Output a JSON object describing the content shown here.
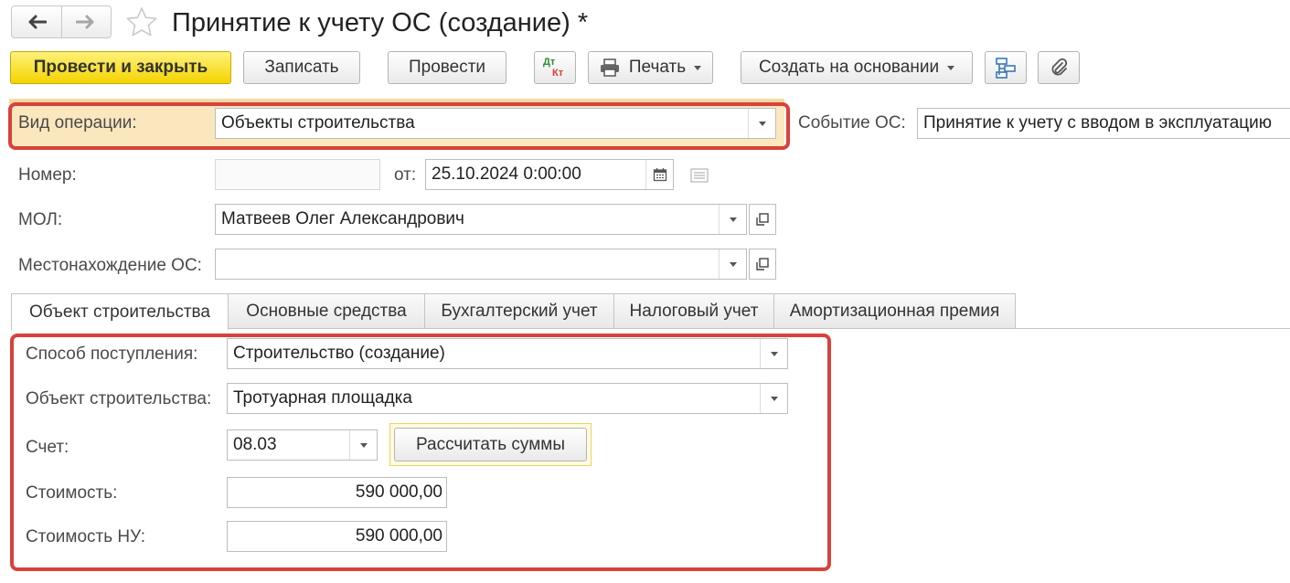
{
  "window": {
    "title": "Принятие к учету ОС (создание) *"
  },
  "toolbar": {
    "post_close": "Провести и закрыть",
    "save": "Записать",
    "post": "Провести",
    "dt": "Дт",
    "kt": "Кт",
    "print": "Печать",
    "create_based": "Создать на основании"
  },
  "header": {
    "operation_label": "Вид операции:",
    "operation_value": "Объекты строительства",
    "event_label": "Событие ОС:",
    "event_value": "Принятие к учету с вводом в эксплуатацию",
    "number_label": "Номер:",
    "number_value": "",
    "date_label": "от:",
    "date_value": "25.10.2024  0:00:00",
    "mol_label": "МОЛ:",
    "mol_value": "Матвеев Олег Александрович",
    "location_label": "Местонахождение ОС:",
    "location_value": ""
  },
  "tabs": [
    {
      "label": "Объект строительства",
      "active": true
    },
    {
      "label": "Основные средства",
      "active": false
    },
    {
      "label": "Бухгалтерский учет",
      "active": false
    },
    {
      "label": "Налоговый учет",
      "active": false
    },
    {
      "label": "Амортизационная премия",
      "active": false
    }
  ],
  "construction": {
    "method_label": "Способ поступления:",
    "method_value": "Строительство (создание)",
    "object_label": "Объект строительства:",
    "object_value": "Тротуарная площадка",
    "account_label": "Счет:",
    "account_value": "08.03",
    "calc_button": "Рассчитать суммы",
    "cost_label": "Стоимость:",
    "cost_value": "590 000,00",
    "cost_tax_label": "Стоимость НУ:",
    "cost_tax_value": "590 000,00"
  },
  "colors": {
    "primary_button": "#f3d300",
    "highlight": "#fbe7bd",
    "outline": "#d8413d"
  }
}
